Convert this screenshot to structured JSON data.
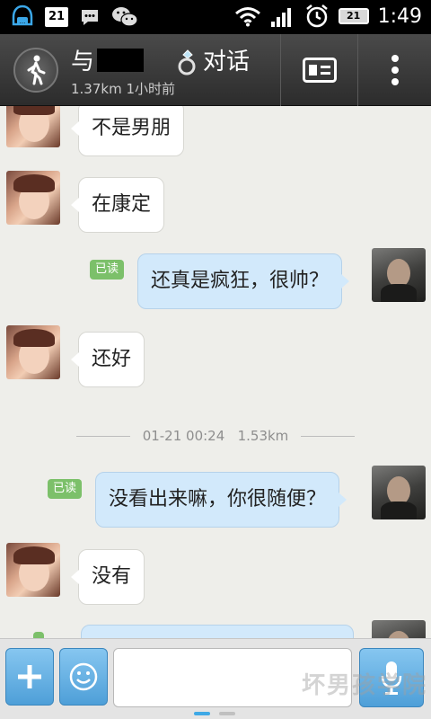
{
  "status_bar": {
    "calendar_day": "21",
    "battery_level": "21",
    "time": "1:49",
    "icons": [
      "qq-icon",
      "calendar-icon",
      "chat-bubble-icon",
      "wechat-icon",
      "wifi-icon",
      "signal-icon",
      "alarm-icon",
      "battery-icon"
    ]
  },
  "title_bar": {
    "name_prefix": "与",
    "name_suffix": "对话",
    "subtitle": "1.37km 1小时前",
    "ring_icon": "ring-icon",
    "left_icon": "walking-person-icon",
    "card_icon": "profile-card-icon",
    "more_icon": "more-vertical-icon"
  },
  "messages": [
    {
      "side": "in",
      "text": "不是男朋"
    },
    {
      "side": "in",
      "text": "在康定"
    },
    {
      "side": "out",
      "text": "还真是疯狂，很帅？",
      "read_label": "已读"
    },
    {
      "side": "in",
      "text": "还好"
    },
    {
      "side": "out",
      "text": "没看出来嘛，你很随便？",
      "read_label": "已读"
    },
    {
      "side": "in",
      "text": "没有"
    }
  ],
  "timestamp": {
    "date_time": "01-21 00:24",
    "distance": "1.53km"
  },
  "input_bar": {
    "plus_icon": "plus-icon",
    "emoji_icon": "smiley-icon",
    "mic_icon": "microphone-icon",
    "input_value": "",
    "input_placeholder": ""
  },
  "watermark": "坏男孩学院",
  "colors": {
    "title_bar": "#3a3a3a",
    "chat_bg": "#eeeeea",
    "bubble_out": "#d2e9fb",
    "bubble_in": "#ffffff",
    "read_badge": "#7cc06a",
    "accent_button": "#5fb0e6"
  }
}
